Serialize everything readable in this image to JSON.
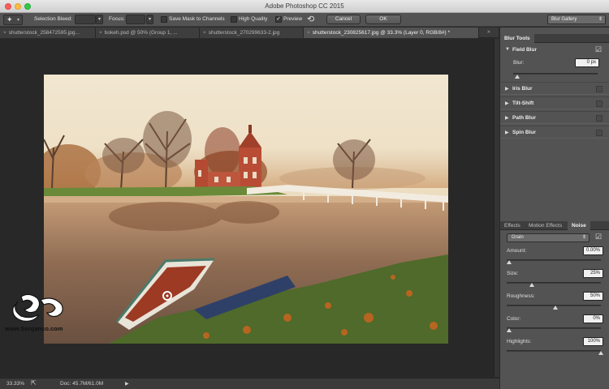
{
  "window": {
    "title": "Adobe Photoshop CC 2015"
  },
  "options_bar": {
    "selection_bleed_label": "Selection Bleed:",
    "selection_bleed_value": "",
    "focus_label": "Focus:",
    "focus_value": "",
    "save_mask_label": "Save Mask to Channels",
    "save_mask_checked": false,
    "high_quality_label": "High Quality",
    "high_quality_checked": false,
    "preview_label": "Preview",
    "preview_checked": true,
    "cancel_label": "Cancel",
    "ok_label": "OK",
    "workspace_value": "Blur Gallery"
  },
  "tabs": [
    {
      "label": "shutterstock_258472595.jpg...",
      "active": false
    },
    {
      "label": "bokeh.psd @ 50% (Group 1, ...",
      "active": false
    },
    {
      "label": "shutterstock_270299633-2.jpg",
      "active": false
    },
    {
      "label": "shutterstock_230825617.jpg @ 33.3% (Layer 0, RGB/8#) *",
      "active": true
    }
  ],
  "status_bar": {
    "zoom": "33.33%",
    "doc": "Doc: 45.7M/61.0M"
  },
  "blur_tools": {
    "panel_title": "Blur Tools",
    "field_blur": {
      "label": "Field Blur",
      "enabled": true,
      "blur_label": "Blur:",
      "blur_value": "0 px",
      "blur_slider": 0.0
    },
    "others": [
      {
        "label": "Iris Blur",
        "enabled": false
      },
      {
        "label": "Tilt-Shift",
        "enabled": false
      },
      {
        "label": "Path Blur",
        "enabled": false
      },
      {
        "label": "Spin Blur",
        "enabled": false
      }
    ]
  },
  "noise_panel": {
    "tabs": [
      "Effects",
      "Motion Effects",
      "Noise"
    ],
    "active_tab": "Noise",
    "type_value": "Grain",
    "type_enabled": true,
    "params": [
      {
        "label": "Amount:",
        "value": "0.00%",
        "level": 0.0
      },
      {
        "label": "Size:",
        "value": "25%",
        "level": 0.25
      },
      {
        "label": "Roughness:",
        "value": "50%",
        "level": 0.5
      },
      {
        "label": "Color:",
        "value": "0%",
        "level": 0.0
      },
      {
        "label": "Highlights:",
        "value": "100%",
        "level": 1.0
      }
    ]
  },
  "watermark": {
    "text": "www.Sorganco.com"
  },
  "colors": {
    "panel_bg": "#535353",
    "canvas_bg": "#282828",
    "title_bar": "#d9d9d9"
  }
}
